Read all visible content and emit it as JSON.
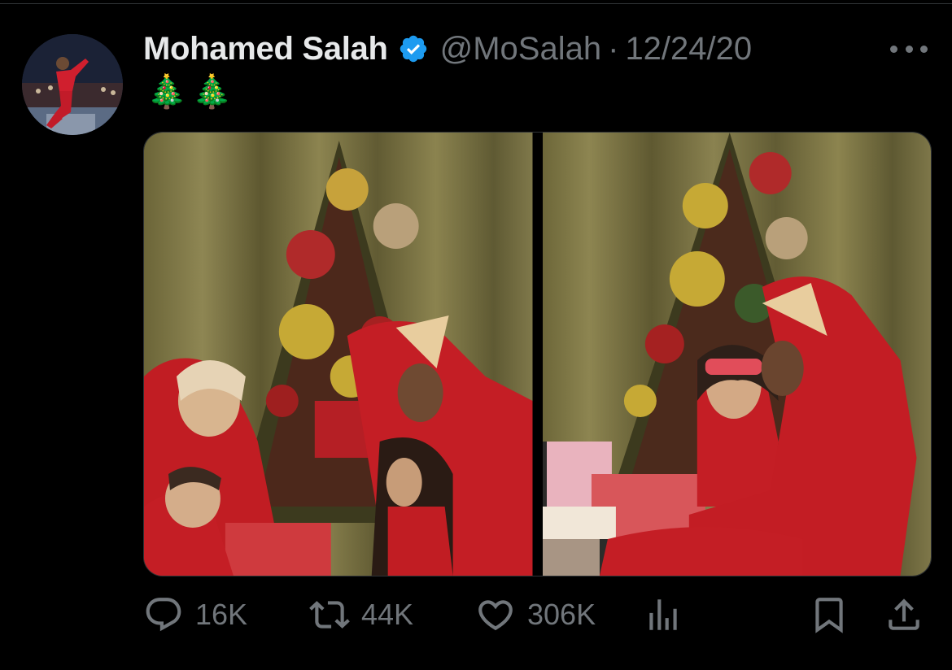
{
  "tweet": {
    "author": {
      "display_name": "Mohamed Salah",
      "handle": "@MoSalah"
    },
    "separator": "·",
    "date": "12/24/20",
    "text": "🎄🎄",
    "media_count": 2
  },
  "actions": {
    "replies": "16K",
    "retweets": "44K",
    "likes": "306K"
  },
  "icons": {
    "reply": "reply-icon",
    "retweet": "retweet-icon",
    "like": "heart-icon",
    "views": "analytics-icon",
    "bookmark": "bookmark-icon",
    "share": "share-icon",
    "more": "more-icon",
    "verified": "verified-badge-icon"
  },
  "colors": {
    "background": "#000000",
    "primary_text": "#e7e9ea",
    "secondary_text": "#71767b",
    "verified_blue": "#1d9bf0"
  }
}
